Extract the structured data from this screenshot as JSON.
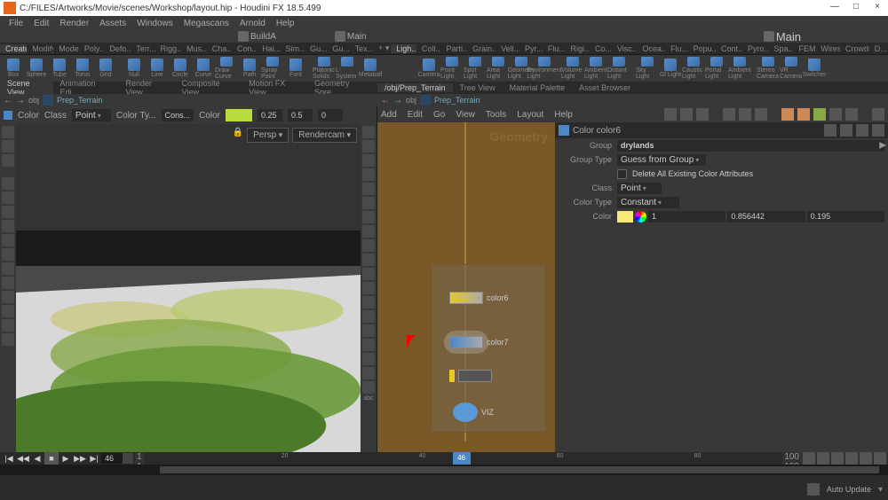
{
  "title_bar": {
    "path": "C:/FILES/Artworks/Movie/scenes/Workshop/layout.hip - Houdini FX 18.5.499"
  },
  "menu": [
    "File",
    "Edit",
    "Render",
    "Assets",
    "Windows",
    "Megascans",
    "Arnold",
    "Help"
  ],
  "banner": {
    "builda": "BuildA",
    "main1": "Main",
    "main2": "Main"
  },
  "shelf_tabs": [
    "Create",
    "Modify",
    "Model",
    "Poly...",
    "Defo...",
    "Terr...",
    "Rigg...",
    "Mus...",
    "Cha...",
    "Con...",
    "Hai...",
    "Sim...",
    "Gu...",
    "Gu...",
    "Tex...",
    "",
    "Ligh...",
    "Coll...",
    "Parti...",
    "Grain...",
    "Vell...",
    "Pyr...",
    "Flu...",
    "Rigi...",
    "Co...",
    "Visc...",
    "Ocea...",
    "Flu...",
    "Popu...",
    "Cont...",
    "Pyro...",
    "Spa...",
    "FEM",
    "Wires",
    "Crowds",
    "D..."
  ],
  "shelf_tools_l": [
    "Box",
    "Sphere",
    "Tube",
    "Torus",
    "Grid",
    "Null",
    "Line",
    "Circle",
    "Curve",
    "Draw Curve",
    "Path",
    "Spray Paint",
    "Font",
    "Platonic Solids",
    "L-System",
    "Metaball"
  ],
  "shelf_tools_r": [
    "Camera",
    "Point Light",
    "Spot Light",
    "Area Light",
    "Geometry Light",
    "Environment Light",
    "",
    "Volume Light",
    "Ambient Light",
    "Distant Light",
    "",
    "Sky Light",
    "Gl Light",
    "Caustic Light",
    "Portal Light",
    "Ambient Light",
    "",
    "Stereo Camera",
    "VR Camera",
    "Switcher"
  ],
  "pane_tabs_l": [
    "Scene View",
    "Animation Edi...",
    "Render View",
    "Composite View",
    "Motion FX View",
    "Geometry Spre..."
  ],
  "pane_tabs_r": [
    "/obj/Prep_Terrain",
    "Tree View",
    "Material Palette",
    "Asset Browser"
  ],
  "path_l": {
    "seg1": "obj",
    "node": "Prep_Terrain"
  },
  "path_r": {
    "seg1": "obj",
    "node": "Prep_Terrain"
  },
  "viewport_params": {
    "color": "Color",
    "class": "Class",
    "point": "Point",
    "colorty": "Color Ty...",
    "cons": "Cons...",
    "color2": "Color",
    "v1": "0.25",
    "v2": "0.5",
    "v3": "0",
    "persp": "Persp",
    "rendercam": "Rendercam"
  },
  "network_menu": [
    "Add",
    "Edit",
    "Go",
    "View",
    "Tools",
    "Layout",
    "Help"
  ],
  "network": {
    "geo": "Geometry",
    "n1": "color6",
    "n2": "color7",
    "n3": "VIZ"
  },
  "params": {
    "header": "Color color6",
    "group": "Group",
    "group_val": "drylands",
    "group_type": "Group Type",
    "group_type_val": "Guess from Group",
    "delete": "Delete All Existing Color Attributes",
    "class": "Class",
    "class_val": "Point",
    "color_type": "Color Type",
    "color_type_val": "Constant",
    "color": "Color",
    "c1": "1",
    "c2": "0.856442",
    "c3": "0.195"
  },
  "timeline": {
    "frame": "46",
    "start": "1",
    "end": "100",
    "marker": "46",
    "ticks": [
      20,
      40,
      60,
      80
    ]
  },
  "status": {
    "auto": "Auto Update"
  }
}
